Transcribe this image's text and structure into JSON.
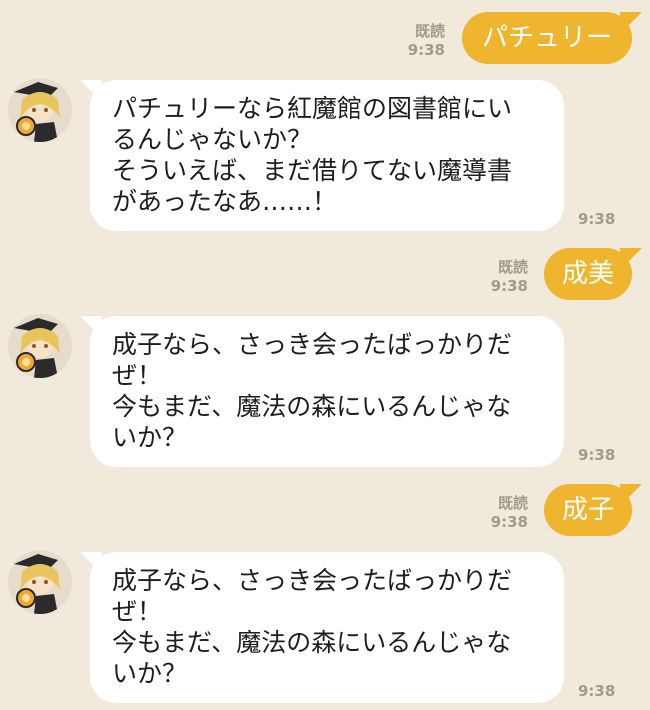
{
  "messages": [
    {
      "type": "sent",
      "text": "パチュリー",
      "read_label": "既読",
      "time": "9:38"
    },
    {
      "type": "received",
      "lines": [
        "パチュリーなら紅魔館の図書館にい",
        "るんじゃないか？",
        "そういえば、まだ借りてない魔導書",
        "があったなあ……！"
      ],
      "time": "9:38"
    },
    {
      "type": "sent",
      "text": "成美",
      "read_label": "既読",
      "time": "9:38"
    },
    {
      "type": "received",
      "lines": [
        "成子なら、さっき会ったばっかりだ",
        "ぜ！",
        "今もまだ、魔法の森にいるんじゃな",
        "いか？"
      ],
      "time": "9:38"
    },
    {
      "type": "sent",
      "text": "成子",
      "read_label": "既読",
      "time": "9:38"
    },
    {
      "type": "received",
      "lines": [
        "成子なら、さっき会ったばっかりだ",
        "ぜ！",
        "今もまだ、魔法の森にいるんじゃな",
        "いか？"
      ],
      "time": "9:38"
    }
  ],
  "colors": {
    "background": "#f0e9dc",
    "sent_bubble": "#efb52f",
    "received_bubble": "#ffffff",
    "meta_text": "#a49a8a"
  },
  "avatar_icon": "character-avatar-icon"
}
